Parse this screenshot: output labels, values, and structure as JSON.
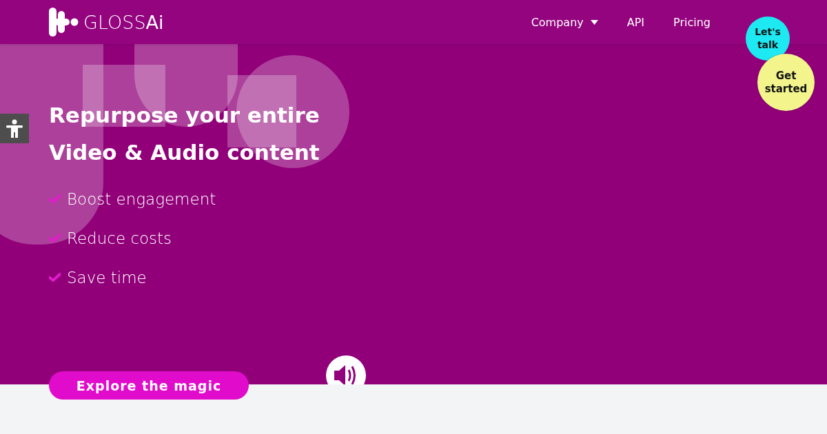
{
  "header": {
    "logo": "GLOSS**Ai**",
    "nav": [
      {
        "label": "Company",
        "kind": "dropdown"
      },
      {
        "label": "API",
        "kind": "link"
      },
      {
        "label": "Pricing",
        "kind": "link"
      }
    ]
  },
  "floating_buttons": [
    {
      "label": "Let's talk",
      "color": "#1de9f2"
    },
    {
      "label": "Get started",
      "color": "#f3f58c"
    }
  ],
  "hero": {
    "headline": [
      "Repurpose your entire",
      "Video & Audio content"
    ],
    "benefits": [
      "Boost engagement",
      "Reduce costs",
      "Save time"
    ],
    "cta": "Explore the magic"
  }
}
